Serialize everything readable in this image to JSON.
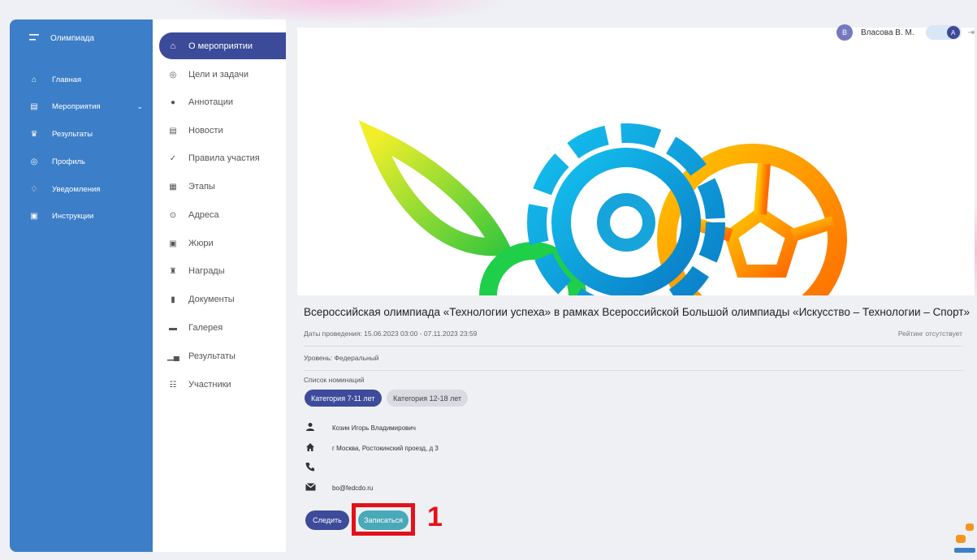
{
  "sidebar": {
    "brand": "Олимпиада",
    "items": [
      {
        "label": "Главная",
        "icon": "home-outline-icon"
      },
      {
        "label": "Мероприятия",
        "icon": "calendar-icon"
      },
      {
        "label": "Результаты",
        "icon": "trophy-icon"
      },
      {
        "label": "Профиль",
        "icon": "profile-icon"
      },
      {
        "label": "Уведомления",
        "icon": "bell-icon"
      },
      {
        "label": "Инструкции",
        "icon": "document-icon"
      }
    ]
  },
  "submenu": {
    "active": "О мероприятии",
    "items": [
      "Цели и задачи",
      "Аннотации",
      "Новости",
      "Правила участия",
      "Этапы",
      "Адреса",
      "Жюри",
      "Награды",
      "Документы",
      "Галерея",
      "Результаты",
      "Участники"
    ]
  },
  "user": {
    "avatar_letter": "В",
    "name": "Власова В. М.",
    "toggle_letter": "A"
  },
  "event": {
    "title": "Всероссийская олимпиада «Технологии успеха» в рамках Всероссийской Большой олимпиады «Искусство – Технологии – Спорт»",
    "dates": "Даты проведения: 15.06.2023 03:00 - 07.11.2023 23:59",
    "rating": "Рейтинг отсутствует",
    "level": "Уровень: Федеральный",
    "nominations_label": "Список номинаций",
    "nominations": [
      "Категория 7-11 лет",
      "Категория 12-18 лет"
    ],
    "contact_person": "Козин Игорь Владимирович",
    "address": "г Москва, Ростокинский проезд, д 3",
    "phone": "",
    "email": "bo@fedcdo.ru"
  },
  "actions": {
    "follow": "Следить",
    "signup": "Записаться"
  },
  "annotation": {
    "marker": "1",
    "color": "#e4101a"
  },
  "colors": {
    "sidebar": "#3d7ec8",
    "accent": "#3b4a99",
    "signup": "#4aa9b8"
  }
}
